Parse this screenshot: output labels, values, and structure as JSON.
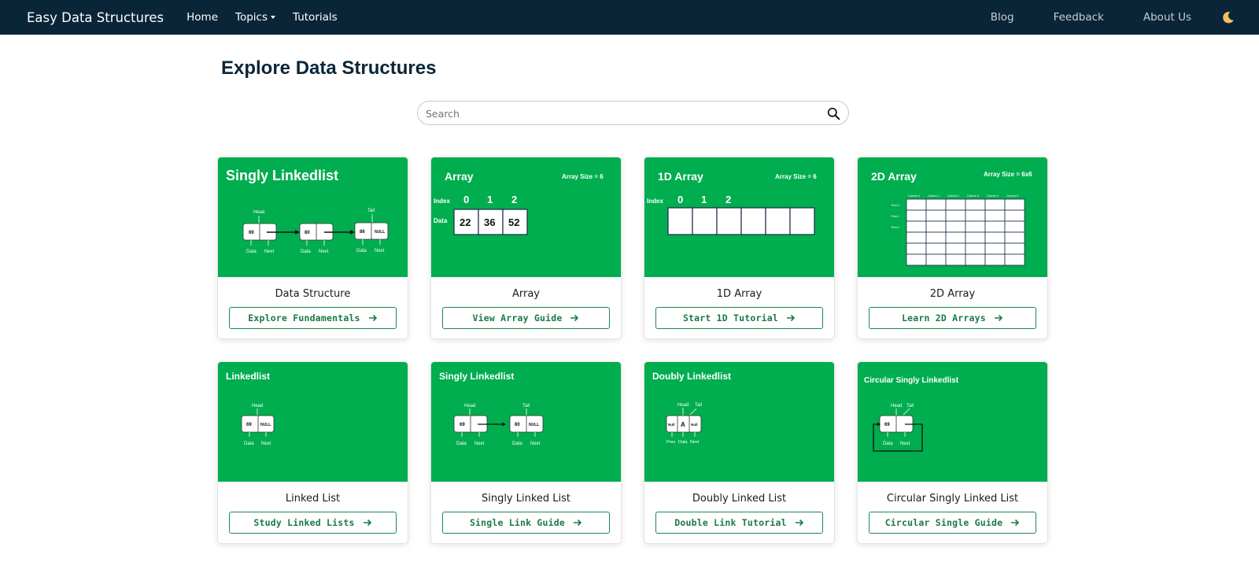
{
  "navbar": {
    "brand": "Easy Data Structures",
    "links": {
      "home": "Home",
      "topics": "Topics",
      "tutorials": "Tutorials"
    },
    "right": {
      "blog": "Blog",
      "feedback": "Feedback",
      "about": "About Us"
    },
    "theme_icon": "moon-icon"
  },
  "page": {
    "title": "Explore Data Structures"
  },
  "search": {
    "placeholder": "Search",
    "value": "",
    "icon": "search-icon"
  },
  "colors": {
    "navbar": "#0b2538",
    "card_green": "#00ad4f",
    "button_green": "#1a7a45"
  },
  "cards": [
    {
      "title": "Data Structure",
      "button": "Explore Fundamentals",
      "thumb": {
        "heading": "Singly Linkedlist",
        "labels": [
          "Head",
          "Tail",
          "69",
          "80",
          "86",
          "NULL",
          "Data",
          "Next",
          "Data",
          "Next",
          "Data",
          "Next"
        ]
      }
    },
    {
      "title": "Array",
      "button": "View Array Guide",
      "thumb": {
        "heading": "Array",
        "size": "Array Size = 6",
        "index_label": "Index",
        "data_label": "Data",
        "indices": [
          "0",
          "1",
          "2"
        ],
        "values": [
          "22",
          "36",
          "52"
        ]
      }
    },
    {
      "title": "1D Array",
      "button": "Start 1D Tutorial",
      "thumb": {
        "heading": "1D Array",
        "size": "Array Size = 6",
        "index_label": "Index",
        "indices": [
          "0",
          "1",
          "2"
        ]
      }
    },
    {
      "title": "2D Array",
      "button": "Learn 2D Arrays",
      "thumb": {
        "heading": "2D Array",
        "size": "Array Size = 6x6",
        "columns": [
          "Column 0",
          "Column 1",
          "Column 2",
          "Column 3",
          "Column 4",
          "Column 5"
        ],
        "rows": [
          "Row 0",
          "Row 1",
          "Row 2"
        ]
      }
    },
    {
      "title": "Linked List",
      "button": "Study Linked Lists",
      "thumb": {
        "heading": "Linkedlist",
        "labels": [
          "Head",
          "69",
          "NULL",
          "Data",
          "Next"
        ]
      }
    },
    {
      "title": "Singly Linked List",
      "button": "Single Link Guide",
      "thumb": {
        "heading": "Singly Linkedlist",
        "labels": [
          "Head",
          "Tail",
          "69",
          "80",
          "NULL",
          "Data",
          "Next",
          "Data",
          "Next"
        ]
      }
    },
    {
      "title": "Doubly Linked List",
      "button": "Double Link Tutorial",
      "thumb": {
        "heading": "Doubly Linkedlist",
        "labels": [
          "Head",
          "Tail",
          "Null",
          "A",
          "Null",
          "Prev",
          "Data",
          "Next"
        ]
      }
    },
    {
      "title": "Circular Singly Linked List",
      "button": "Circular Single Guide",
      "thumb": {
        "heading": "Circular Singly Linkedlist",
        "labels": [
          "Head",
          "Tail",
          "69",
          "Data",
          "Next"
        ]
      }
    }
  ]
}
